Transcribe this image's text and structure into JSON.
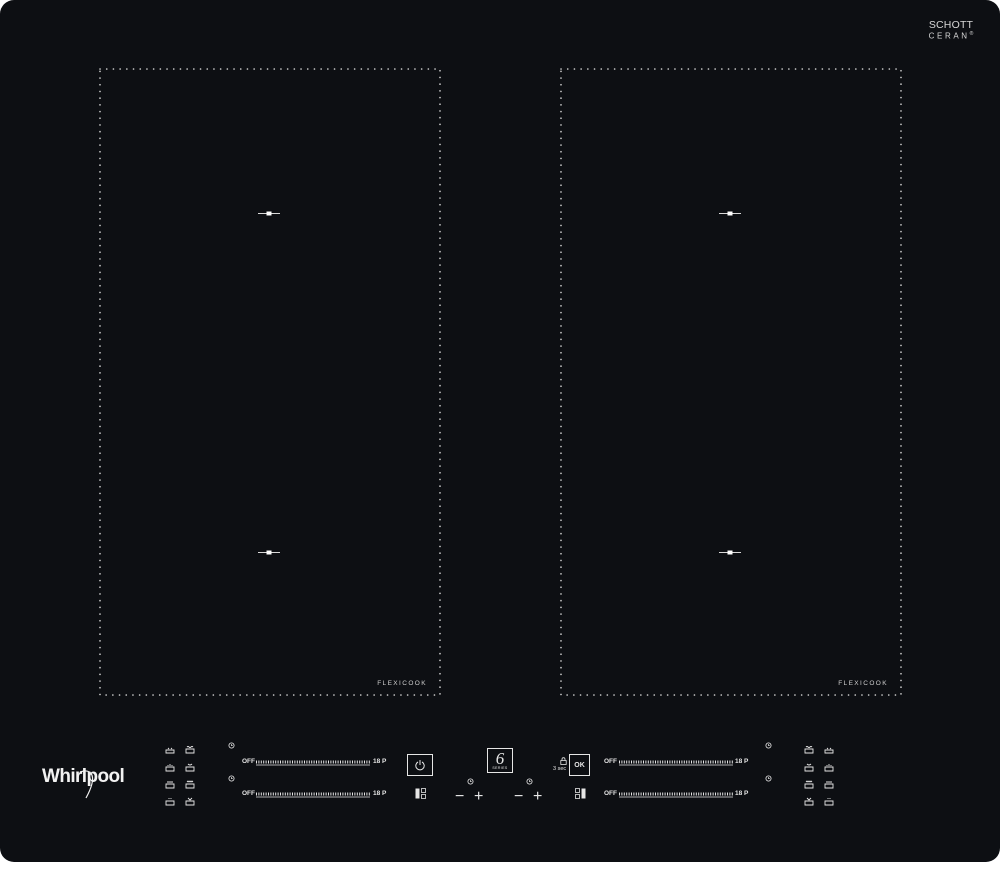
{
  "brand": {
    "schott_line1": "SCHOTT",
    "schott_line2": "CERAN",
    "schott_reg": "®",
    "logo": "Whirlpool"
  },
  "zones": [
    {
      "label": "FLEXICOOK"
    },
    {
      "label": "FLEXICOOK"
    }
  ],
  "sliders": [
    {
      "off": "OFF",
      "max": "18 P"
    },
    {
      "off": "OFF",
      "max": "18 P"
    },
    {
      "off": "OFF",
      "max": "18 P"
    },
    {
      "off": "OFF",
      "max": "18 P"
    }
  ],
  "controls": {
    "ok_label": "OK",
    "lock_label": "3 sec",
    "series_number": "6",
    "series_label": "SERIES",
    "minus": "−",
    "plus": "+"
  },
  "icons": {
    "power": "power-icon",
    "flexi_left": "flexi-zone-icon",
    "flexi_right": "flexi-zone-icon",
    "timer": "timer-icon",
    "lock": "lock-icon",
    "functions": [
      "melt-icon",
      "simmer-icon",
      "keep-warm-icon",
      "boil-icon",
      "fry-icon",
      "grill-icon",
      "pan-icon",
      "wok-icon"
    ]
  },
  "colors": {
    "glass": "#0d0f13",
    "print": "#e6e6e6"
  }
}
